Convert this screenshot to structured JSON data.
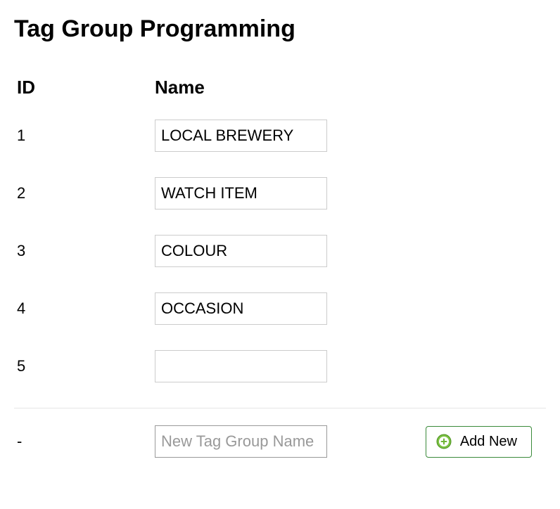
{
  "title": "Tag Group Programming",
  "columns": {
    "id": "ID",
    "name": "Name"
  },
  "rows": [
    {
      "id": "1",
      "name": "LOCAL BREWERY"
    },
    {
      "id": "2",
      "name": "WATCH ITEM"
    },
    {
      "id": "3",
      "name": "COLOUR"
    },
    {
      "id": "4",
      "name": "OCCASION"
    },
    {
      "id": "5",
      "name": ""
    }
  ],
  "newRow": {
    "id": "-",
    "placeholder": "New Tag Group Name",
    "value": ""
  },
  "addButton": {
    "label": "Add New"
  }
}
